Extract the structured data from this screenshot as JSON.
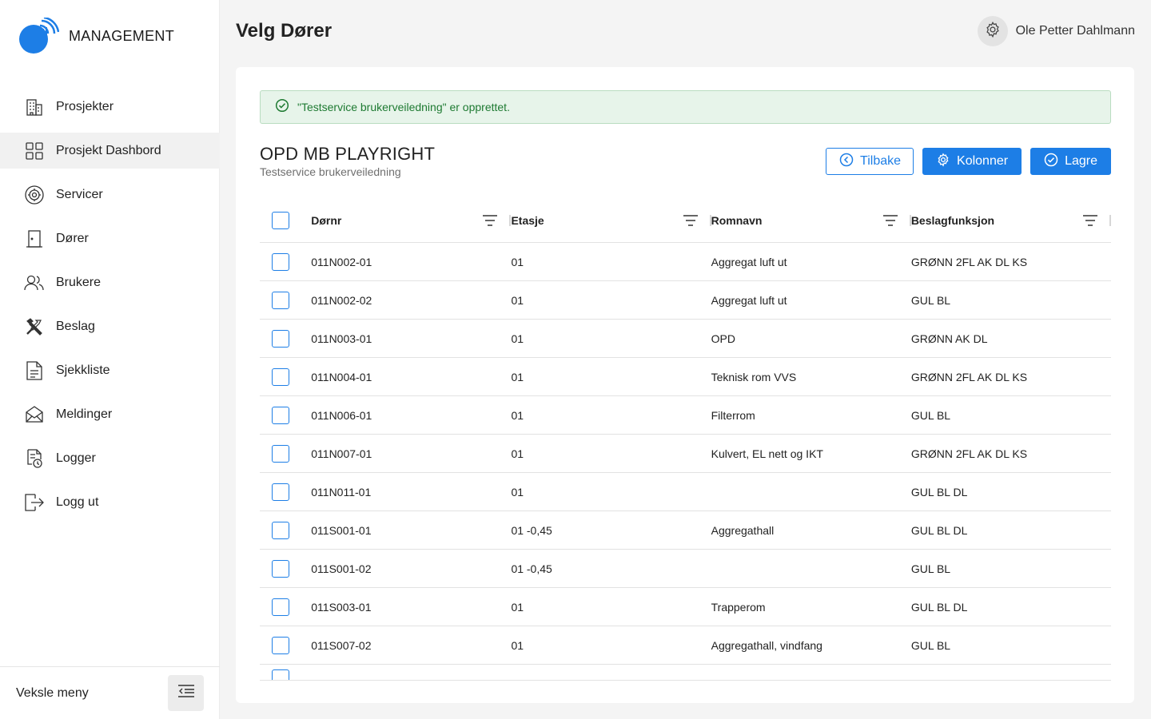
{
  "brand": {
    "name": "MANAGEMENT"
  },
  "sidebar": {
    "items": [
      {
        "label": "Prosjekter",
        "icon": "building-icon"
      },
      {
        "label": "Prosjekt Dashbord",
        "icon": "dashboard-grid-icon",
        "active": true
      },
      {
        "label": "Servicer",
        "icon": "service-gear-icon"
      },
      {
        "label": "Dører",
        "icon": "door-icon"
      },
      {
        "label": "Brukere",
        "icon": "users-icon"
      },
      {
        "label": "Beslag",
        "icon": "tools-icon"
      },
      {
        "label": "Sjekkliste",
        "icon": "checklist-document-icon"
      },
      {
        "label": "Meldinger",
        "icon": "mail-icon"
      },
      {
        "label": "Logger",
        "icon": "log-clock-icon"
      },
      {
        "label": "Logg ut",
        "icon": "logout-icon"
      }
    ],
    "footer": {
      "label": "Veksle meny"
    }
  },
  "header": {
    "title": "Velg Dører",
    "user_name": "Ole Petter Dahlmann"
  },
  "alert": {
    "text": "\"Testservice brukerveiledning\" er opprettet."
  },
  "project": {
    "title": "OPD MB PLAYRIGHT",
    "subtitle": "Testservice brukerveiledning"
  },
  "actions": {
    "back": "Tilbake",
    "columns": "Kolonner",
    "save": "Lagre"
  },
  "table": {
    "columns": [
      "Dørnr",
      "Etasje",
      "Romnavn",
      "Beslagfunksjon"
    ],
    "rows": [
      [
        "011N002-01",
        "01",
        "Aggregat luft ut",
        "GRØNN 2FL AK DL KS"
      ],
      [
        "011N002-02",
        "01",
        "Aggregat luft ut",
        "GUL BL"
      ],
      [
        "011N003-01",
        "01",
        "OPD",
        "GRØNN AK DL"
      ],
      [
        "011N004-01",
        "01",
        "Teknisk rom VVS",
        "GRØNN 2FL AK DL KS"
      ],
      [
        "011N006-01",
        "01",
        "Filterrom",
        "GUL BL"
      ],
      [
        "011N007-01",
        "01",
        "Kulvert, EL nett og IKT",
        "GRØNN 2FL AK DL KS"
      ],
      [
        "011N011-01",
        "01",
        "",
        "GUL BL DL"
      ],
      [
        "011S001-01",
        "01 -0,45",
        "Aggregathall",
        "GUL BL DL"
      ],
      [
        "011S001-02",
        "01 -0,45",
        "",
        "GUL BL"
      ],
      [
        "011S003-01",
        "01",
        "Trapperom",
        "GUL BL DL"
      ],
      [
        "011S007-02",
        "01",
        "Aggregathall, vindfang",
        "GUL BL"
      ]
    ]
  },
  "colors": {
    "accent": "#1d7ee6",
    "success_bg": "#e7f4ea",
    "success_text": "#1e7a32"
  }
}
